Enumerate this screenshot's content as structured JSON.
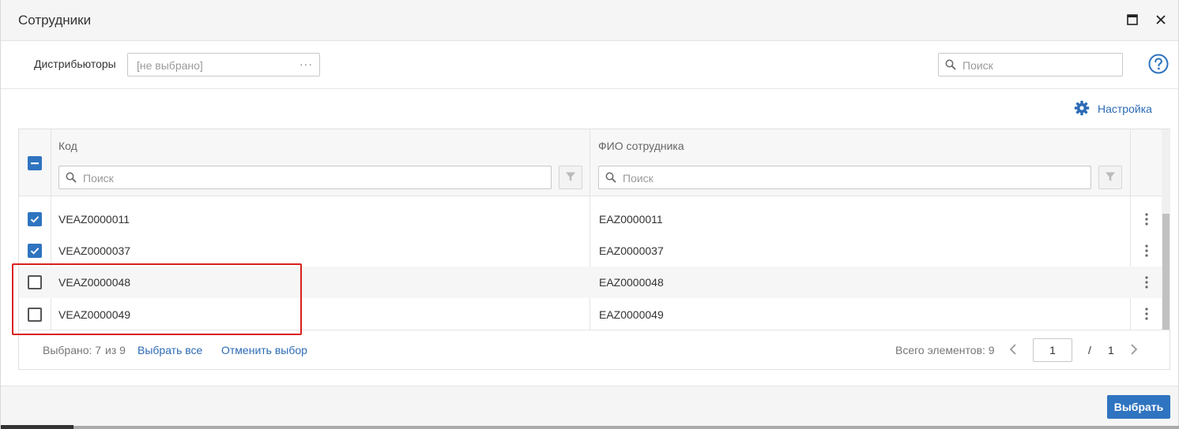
{
  "window": {
    "title": "Сотрудники",
    "icons": [
      "maximize-icon",
      "close-icon"
    ]
  },
  "filters": {
    "distributors_label": "Дистрибьюторы",
    "distributors_placeholder": "[не выбрано]",
    "distributors_button": "···",
    "search_placeholder": "Поиск",
    "help_icon": "help-icon"
  },
  "toolbar": {
    "settings_label": "Настройка",
    "settings_icon": "gear-icon"
  },
  "grid": {
    "columns": [
      {
        "title": "Код",
        "search_placeholder": "Поиск"
      },
      {
        "title": "ФИО сотрудника",
        "search_placeholder": "Поиск"
      }
    ],
    "header_checkbox_state": "indeterminate",
    "rows": [
      {
        "code": "VEAZ0000011",
        "name": "EAZ0000011",
        "checked": true
      },
      {
        "code": "VEAZ0000037",
        "name": "EAZ0000037",
        "checked": true
      },
      {
        "code": "VEAZ0000048",
        "name": "EAZ0000048",
        "checked": false
      },
      {
        "code": "VEAZ0000049",
        "name": "EAZ0000049",
        "checked": false
      }
    ]
  },
  "footer": {
    "selected_text": "Выбрано: 7",
    "of_text": "из 9",
    "select_all": "Выбрать все",
    "clear_selection": "Отменить выбор",
    "total_text": "Всего элементов: 9",
    "page_current": "1",
    "page_separator": "/",
    "page_total": "1"
  },
  "actions": {
    "select_button": "Выбрать"
  },
  "colors": {
    "accent": "#2f74c0",
    "link": "#2c6bb5",
    "highlight": "#d82020"
  }
}
